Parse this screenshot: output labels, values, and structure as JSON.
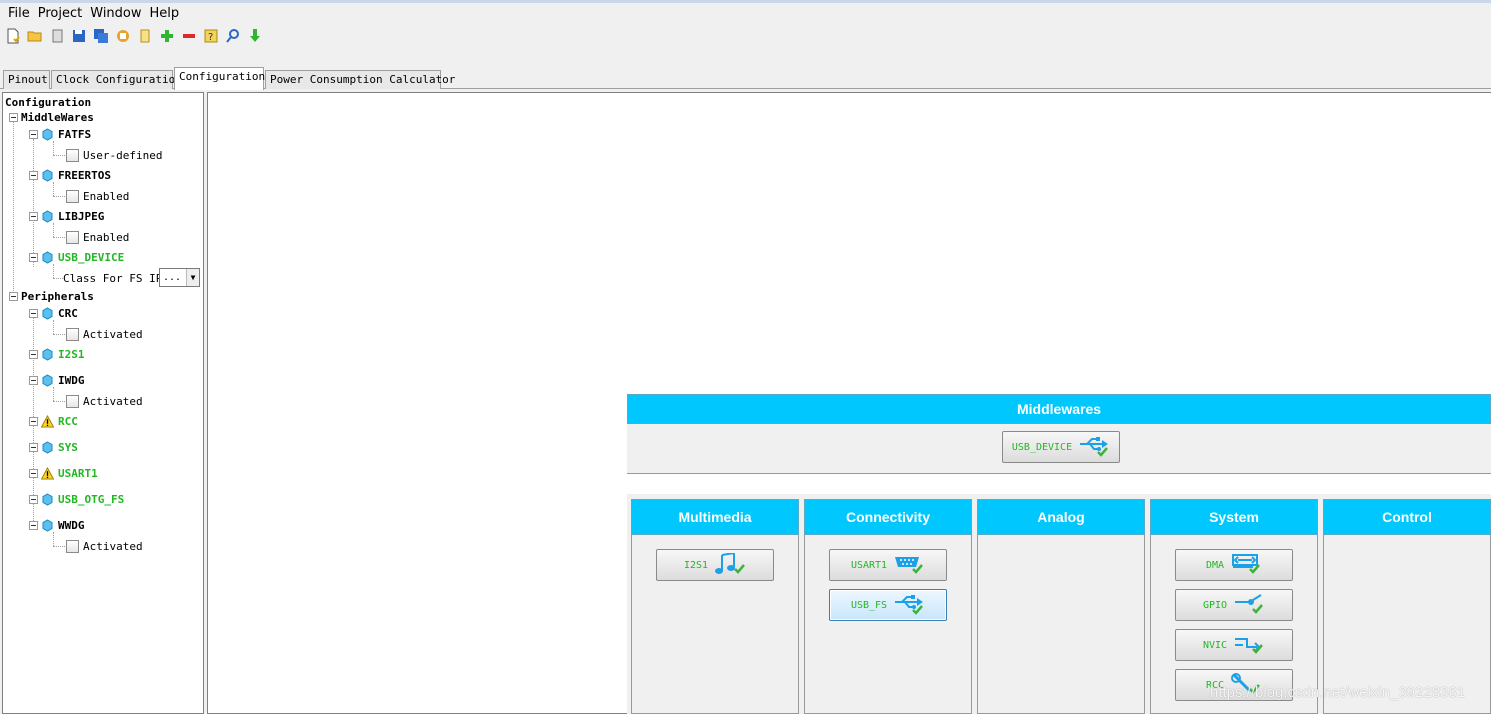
{
  "menu": [
    "File",
    "Project",
    "Window",
    "Help"
  ],
  "toolbar": {
    "icons": [
      "new-project-icon",
      "open-folder-icon",
      "copy-icon",
      "save-icon",
      "save-all-icon",
      "generate-report-icon",
      "script-icon",
      "add-icon",
      "remove-icon",
      "help-icon",
      "search-icon",
      "download-icon"
    ]
  },
  "tabs": [
    "Pinout",
    "Clock Configuration",
    "Configuration",
    "Power Consumption Calculator"
  ],
  "active_tab": "Configuration",
  "tree": {
    "root": "Configuration",
    "middlewares_label": "MiddleWares",
    "peripherals_label": "Peripherals",
    "fatfs": {
      "label": "FATFS",
      "option": "User-defined"
    },
    "freertos": {
      "label": "FREERTOS",
      "option": "Enabled"
    },
    "libjpeg": {
      "label": "LIBJPEG",
      "option": "Enabled"
    },
    "usb_device": {
      "label": "USB_DEVICE",
      "option": "Class For FS IP",
      "combo_value": "..."
    },
    "crc": {
      "label": "CRC",
      "option": "Activated"
    },
    "i2s1": {
      "label": "I2S1"
    },
    "iwdg": {
      "label": "IWDG",
      "option": "Activated"
    },
    "rcc": {
      "label": "RCC"
    },
    "sys": {
      "label": "SYS"
    },
    "usart1": {
      "label": "USART1"
    },
    "usb_otg_fs": {
      "label": "USB_OTG_FS"
    },
    "wwdg": {
      "label": "WWDG",
      "option": "Activated"
    }
  },
  "middlewares_panel": {
    "title": "Middlewares",
    "buttons": [
      "USB_DEVICE"
    ]
  },
  "categories": [
    {
      "title": "Multimedia",
      "buttons": [
        "I2S1"
      ]
    },
    {
      "title": "Connectivity",
      "buttons": [
        "USART1",
        "USB_FS"
      ]
    },
    {
      "title": "Analog",
      "buttons": []
    },
    {
      "title": "System",
      "buttons": [
        "DMA",
        "GPIO",
        "NVIC",
        "RCC"
      ]
    },
    {
      "title": "Control",
      "buttons": []
    }
  ],
  "colors": {
    "header_cyan": "#00c8ff",
    "enabled_green": "#22b822",
    "icon_blue": "#1ea0e6"
  },
  "watermark": "https://blog.csdn.net/weixin_39228381"
}
